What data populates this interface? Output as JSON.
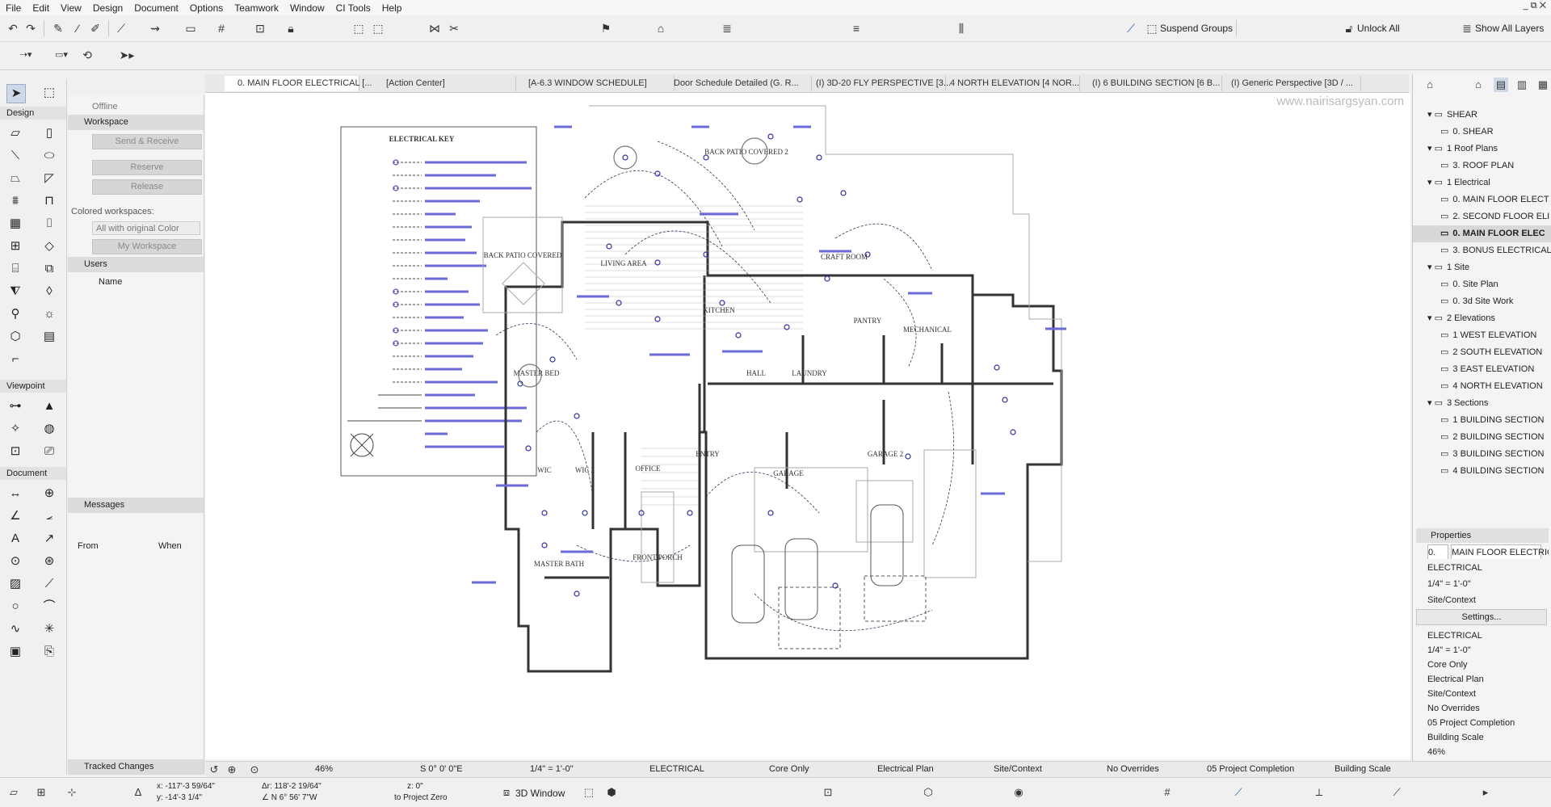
{
  "menu": [
    "File",
    "Edit",
    "View",
    "Design",
    "Document",
    "Options",
    "Teamwork",
    "Window",
    "CI Tools",
    "Help"
  ],
  "window_controls": "_ ⧉ ✕",
  "toolbar": {
    "suspend_groups": "Suspend Groups",
    "unlock_all": "Unlock All",
    "show_all_layers": "Show All Layers"
  },
  "toolbox": {
    "sections": [
      "Design",
      "Viewpoint",
      "Document"
    ]
  },
  "left_panel": {
    "status": "Offline",
    "workspace_title": "Workspace",
    "send_receive": "Send & Receive",
    "reserve": "Reserve",
    "release": "Release",
    "colored_workspaces_label": "Colored workspaces:",
    "colored_select": "All with original Color",
    "my_workspace": "My Workspace",
    "users_title": "Users",
    "user_name": "Name",
    "messages_title": "Messages",
    "from_label": "From",
    "when_label": "When",
    "tracked_changes": "Tracked Changes"
  },
  "tabs": [
    {
      "label": "0. MAIN FLOOR ELECTRICAL [..."
    },
    {
      "label": "[Action Center]"
    },
    {
      "label": "[A-6.3 WINDOW SCHEDULE]"
    },
    {
      "label": "Door Schedule Detailed (G. R..."
    },
    {
      "label": "(I) 3D-20 FLY PERSPECTIVE [3..."
    },
    {
      "label": "4 NORTH ELEVATION [4 NOR..."
    },
    {
      "label": "(I) 6 BUILDING SECTION [6 B..."
    },
    {
      "label": "(I) Generic Perspective [3D / ..."
    }
  ],
  "watermark": "www.nairisargsyan.com",
  "drawing": {
    "key_title": "ELECTRICAL KEY",
    "rooms": [
      {
        "name": "BACK PATIO COVERED"
      },
      {
        "name": "BACK PATIO COVERED 2"
      },
      {
        "name": "LIVING AREA"
      },
      {
        "name": "KITCHEN"
      },
      {
        "name": "CRAFT ROOM"
      },
      {
        "name": "PANTRY"
      },
      {
        "name": "MECHANICAL"
      },
      {
        "name": "MASTER BED"
      },
      {
        "name": "HALL"
      },
      {
        "name": "LAUNDRY"
      },
      {
        "name": "WIC"
      },
      {
        "name": "WIC 2"
      },
      {
        "name": "OFFICE"
      },
      {
        "name": "ENTRY"
      },
      {
        "name": "GARAGE"
      },
      {
        "name": "GARAGE 2"
      },
      {
        "name": "MASTER BATH"
      },
      {
        "name": "FRONT PORCH"
      }
    ]
  },
  "navigator": {
    "items": [
      {
        "label": "SHEAR",
        "level": 1,
        "folder": true
      },
      {
        "label": "0. SHEAR",
        "level": 2,
        "folder": false
      },
      {
        "label": "1 Roof Plans",
        "level": 1,
        "folder": true
      },
      {
        "label": "3. ROOF PLAN",
        "level": 2,
        "folder": false
      },
      {
        "label": "1 Electrical",
        "level": 1,
        "folder": true
      },
      {
        "label": "0. MAIN FLOOR ELECT",
        "level": 2,
        "folder": false
      },
      {
        "label": "2. SECOND FLOOR ELI",
        "level": 2,
        "folder": false
      },
      {
        "label": "0. MAIN FLOOR ELEC",
        "level": 2,
        "folder": false,
        "selected": true
      },
      {
        "label": "3. BONUS ELECTRICAL",
        "level": 2,
        "folder": false
      },
      {
        "label": "1 Site",
        "level": 1,
        "folder": true
      },
      {
        "label": "0. Site Plan",
        "level": 2,
        "folder": false
      },
      {
        "label": "0. 3d Site Work",
        "level": 2,
        "folder": false
      },
      {
        "label": "2 Elevations",
        "level": 1,
        "folder": true
      },
      {
        "label": "1 WEST ELEVATION",
        "level": 2,
        "folder": false
      },
      {
        "label": "2 SOUTH ELEVATION",
        "level": 2,
        "folder": false
      },
      {
        "label": "3 EAST ELEVATION",
        "level": 2,
        "folder": false
      },
      {
        "label": "4 NORTH ELEVATION",
        "level": 2,
        "folder": false
      },
      {
        "label": "3 Sections",
        "level": 1,
        "folder": true
      },
      {
        "label": "1 BUILDING SECTION",
        "level": 2,
        "folder": false
      },
      {
        "label": "2 BUILDING SECTION",
        "level": 2,
        "folder": false
      },
      {
        "label": "3 BUILDING SECTION",
        "level": 2,
        "folder": false
      },
      {
        "label": "4 BUILDING SECTION",
        "level": 2,
        "folder": false
      }
    ]
  },
  "properties": {
    "title": "Properties",
    "id": "0.",
    "name": "MAIN FLOOR ELECTRICAL",
    "layer": "ELECTRICAL",
    "scale": "1/4\"   =   1'-0\"",
    "site_context": "Site/Context",
    "settings_button": "Settings...",
    "rows": [
      "ELECTRICAL",
      "1/4\"   =   1'-0\"",
      "Core Only",
      "Electrical Plan",
      "Site/Context",
      "No Overrides",
      "05 Project Completion",
      "Building Scale",
      "46%",
      "S 0° 0' 0\"E"
    ]
  },
  "statusbar": {
    "zoom": "46%",
    "angle": "S 0° 0' 0\"E",
    "scale": "1/4\"    =    1'-0\"",
    "layer_combo": "ELECTRICAL",
    "model_view": "Core Only",
    "pen_set": "Electrical Plan",
    "graphic_override": "Site/Context",
    "overrides": "No Overrides",
    "renovation": "05 Project Completion",
    "dimension": "Building Scale"
  },
  "bottombar": {
    "x": "x: -117'-3 59/64\"",
    "y": "y: -14'-3 1/4\"",
    "dr": "Δr: 118'-2 19/64\"",
    "dir": "∠ N 6° 56' 7\"W",
    "z": "z: 0\"",
    "zero": "to Project Zero",
    "window3d": "3D Window"
  }
}
